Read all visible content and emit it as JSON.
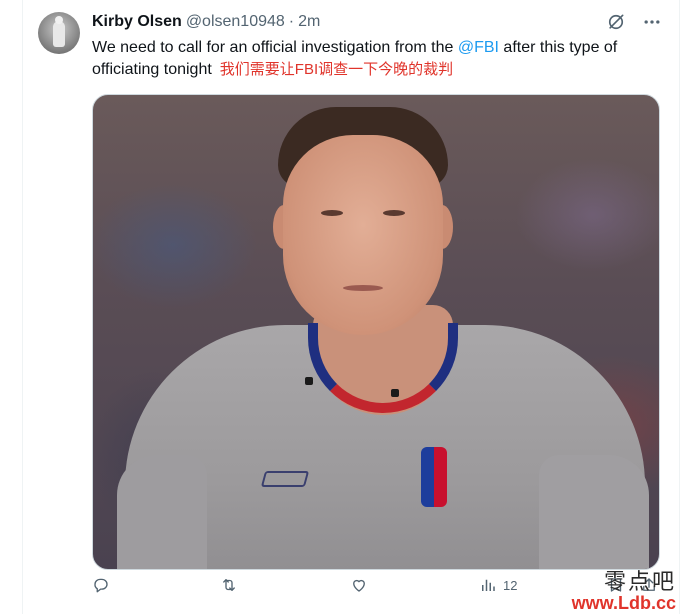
{
  "tweet": {
    "author_name": "Kirby Olsen",
    "handle": "@olsen10948",
    "separator": "·",
    "time": "2m",
    "text_before": "We need to call for an official investigation from the ",
    "mention": "@FBI",
    "text_after": " after this type of officiating tonight",
    "translation_note": "我们需要让FBI调查一下今晚的裁判"
  },
  "top_icons": [
    "grok-icon",
    "more-icon"
  ],
  "actions": {
    "views_count": "12"
  },
  "watermark": {
    "top": "零点吧",
    "bottom": "www.Ldb.cc"
  },
  "colors": {
    "text": "#0f1419",
    "secondary": "#536471",
    "link": "#1d9bf0",
    "note_red": "#e0342b"
  }
}
